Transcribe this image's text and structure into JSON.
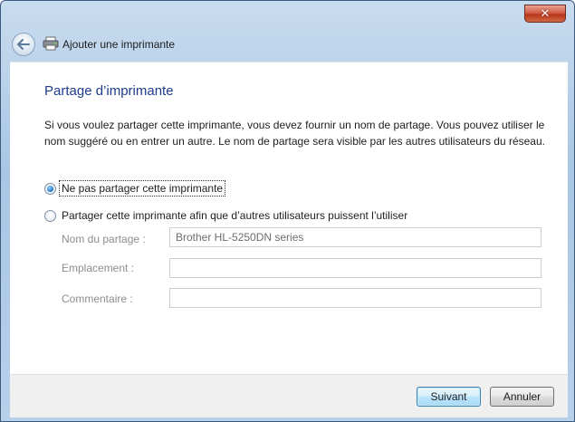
{
  "window": {
    "title": "Ajouter une imprimante",
    "close_glyph": "✕"
  },
  "icons": {
    "back": "back-arrow-icon",
    "printer": "printer-icon",
    "close": "close-icon"
  },
  "page": {
    "heading": "Partage d’imprimante",
    "description": "Si vous voulez partager cette imprimante, vous devez fournir un nom de partage. Vous pouvez utiliser le nom suggéré ou en entrer un autre. Le nom de partage sera visible par les autres utilisateurs du réseau."
  },
  "options": {
    "no_share": {
      "label": "Ne pas partager cette imprimante",
      "selected": true
    },
    "share": {
      "label": "Partager cette imprimante afin que d’autres utilisateurs puissent l’utiliser",
      "selected": false
    }
  },
  "fields": {
    "share_name": {
      "label": "Nom du partage :",
      "value": "Brother HL-5250DN series"
    },
    "location": {
      "label": "Emplacement :",
      "value": ""
    },
    "comment": {
      "label": "Commentaire :",
      "value": ""
    }
  },
  "buttons": {
    "next": "Suivant",
    "cancel": "Annuler"
  },
  "colors": {
    "heading": "#1e3c8c",
    "frame": "#a9c6e4",
    "disabled_text": "#8d8d8d"
  }
}
